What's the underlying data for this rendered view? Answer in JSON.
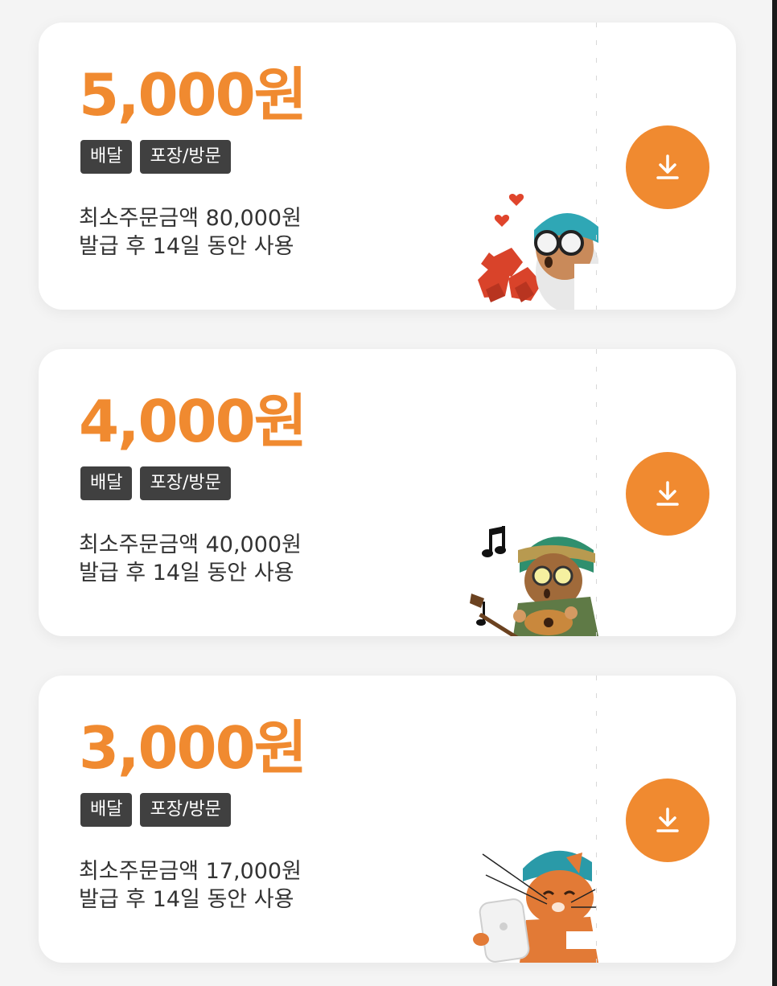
{
  "coupons": [
    {
      "amount": "5,000원",
      "tags": [
        "배달",
        "포장/방문"
      ],
      "min_order": "최소주문금액 80,000원",
      "validity": "발급 후 14일 동안 사용",
      "illustration": "character-blowing-hearts"
    },
    {
      "amount": "4,000원",
      "tags": [
        "배달",
        "포장/방문"
      ],
      "min_order": "최소주문금액 40,000원",
      "validity": "발급 후 14일 동안 사용",
      "illustration": "character-playing-guitar"
    },
    {
      "amount": "3,000원",
      "tags": [
        "배달",
        "포장/방문"
      ],
      "min_order": "최소주문금액 17,000원",
      "validity": "발급 후 14일 동안 사용",
      "illustration": "cat-with-tablet"
    }
  ],
  "icons": {
    "download": "download-icon"
  },
  "colors": {
    "accent": "#f08a30",
    "tag_bg": "#404040",
    "card_bg": "#ffffff",
    "page_bg": "#f4f4f4"
  }
}
